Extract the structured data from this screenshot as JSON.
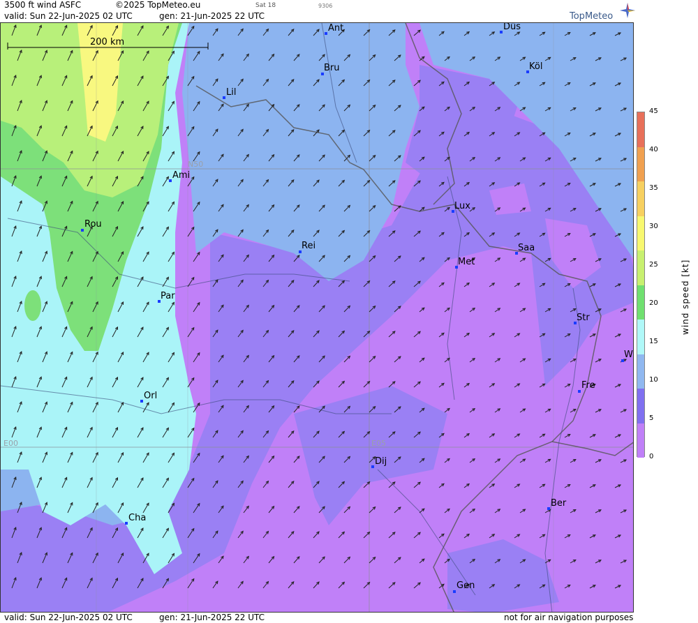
{
  "header": {
    "title": "3500 ft wind ASFC",
    "copyright": "©2025 TopMeteo.eu",
    "day_label": "Sat 18",
    "code": "9306",
    "valid": "valid:  Sun  22-Jun-2025  02 UTC",
    "generated": "gen: 21-Jun-2025 22 UTC"
  },
  "logo": {
    "text": "TopMeteo",
    "icon": "compass-star-icon"
  },
  "scale_bar": {
    "label": "200 km"
  },
  "grid_labels": [
    "N50",
    "E00",
    "E05"
  ],
  "cities": [
    {
      "name": "Ant"
    },
    {
      "name": "Düs"
    },
    {
      "name": "Bru"
    },
    {
      "name": "Köl"
    },
    {
      "name": "Lil"
    },
    {
      "name": "Ami"
    },
    {
      "name": "Rou"
    },
    {
      "name": "Lux"
    },
    {
      "name": "Rei"
    },
    {
      "name": "Saa"
    },
    {
      "name": "Met"
    },
    {
      "name": "Par"
    },
    {
      "name": "Str"
    },
    {
      "name": "W"
    },
    {
      "name": "Fre"
    },
    {
      "name": "Orl"
    },
    {
      "name": "Dij"
    },
    {
      "name": "Ber"
    },
    {
      "name": "Cha"
    },
    {
      "name": "Gen"
    }
  ],
  "footer": {
    "valid": "valid:  Sun  22-Jun-2025  02 UTC",
    "generated": "gen: 21-Jun-2025 22 UTC",
    "disclaimer": "not for air navigation purposes"
  },
  "legend": {
    "title": "wind speed [kt]",
    "ticks": [
      "45",
      "40",
      "35",
      "30",
      "25",
      "20",
      "15",
      "10",
      "5",
      "0"
    ],
    "colors": [
      "#e8705a",
      "#f0a050",
      "#f7d060",
      "#f8f870",
      "#c8f070",
      "#70e070",
      "#b0f8f8",
      "#90b8f0",
      "#8070f0",
      "#c080f8"
    ]
  },
  "colors": {
    "purple": "#c080f8",
    "violet": "#9a80f4",
    "blue": "#8cb4f0",
    "cyan": "#aaf4f8",
    "green": "#7de07a",
    "lightgreen": "#b8f07a",
    "yellow": "#f8f880"
  }
}
